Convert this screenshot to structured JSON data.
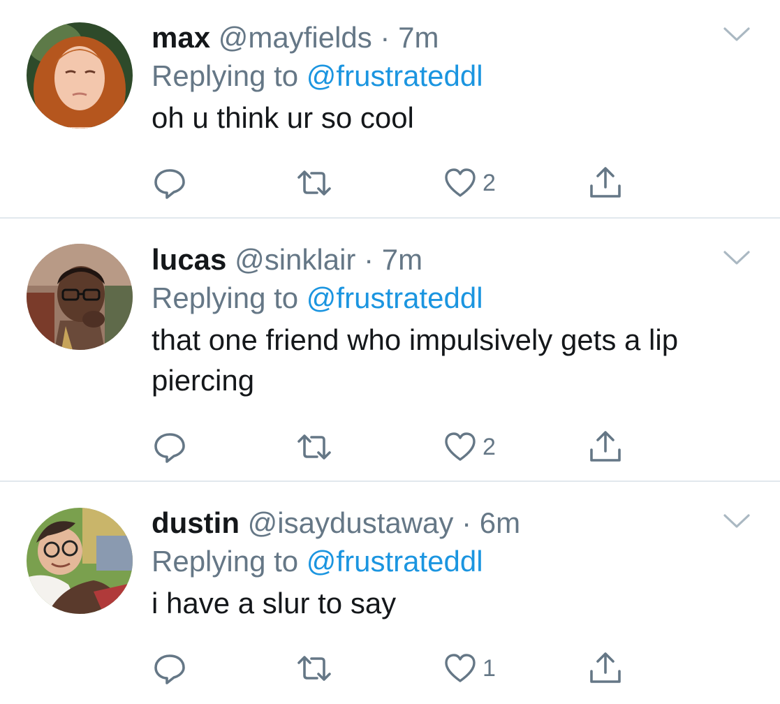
{
  "tweets": [
    {
      "display_name": "max",
      "handle": "@mayfields",
      "separator": " · ",
      "time": "7m",
      "replying_prefix": "Replying to ",
      "replying_handle": "@frustrateddl",
      "text": "oh u think ur so cool",
      "like_count": "2",
      "avatar_colors": {
        "background": "#2e4a2a",
        "hair": "#b5561e",
        "face": "#f3c7ad"
      }
    },
    {
      "display_name": "lucas",
      "handle": "@sinklair",
      "separator": " · ",
      "time": "7m",
      "replying_prefix": "Replying to ",
      "replying_handle": "@frustrateddl",
      "text": "that one friend who impulsively gets a lip piercing",
      "like_count": "2",
      "avatar_colors": {
        "background": "#9a7a68",
        "hair": "#1f1410",
        "face": "#5b3a2a"
      }
    },
    {
      "display_name": "dustin",
      "handle": "@isaydustaway",
      "separator": " · ",
      "time": "6m",
      "replying_prefix": "Replying to ",
      "replying_handle": "@frustrateddl",
      "text": "i have a slur to say",
      "like_count": "1",
      "avatar_colors": {
        "background": "#7aa04e",
        "hair": "#3a2a22",
        "face": "#e4b89a"
      }
    }
  ],
  "icons": {
    "reply": "reply-icon",
    "retweet": "retweet-icon",
    "like": "heart-icon",
    "share": "share-icon",
    "caret": "chevron-down-icon"
  },
  "colors": {
    "text_primary": "#14171a",
    "text_secondary": "#657786",
    "link": "#1b95e0",
    "divider": "#e1e8ed"
  }
}
